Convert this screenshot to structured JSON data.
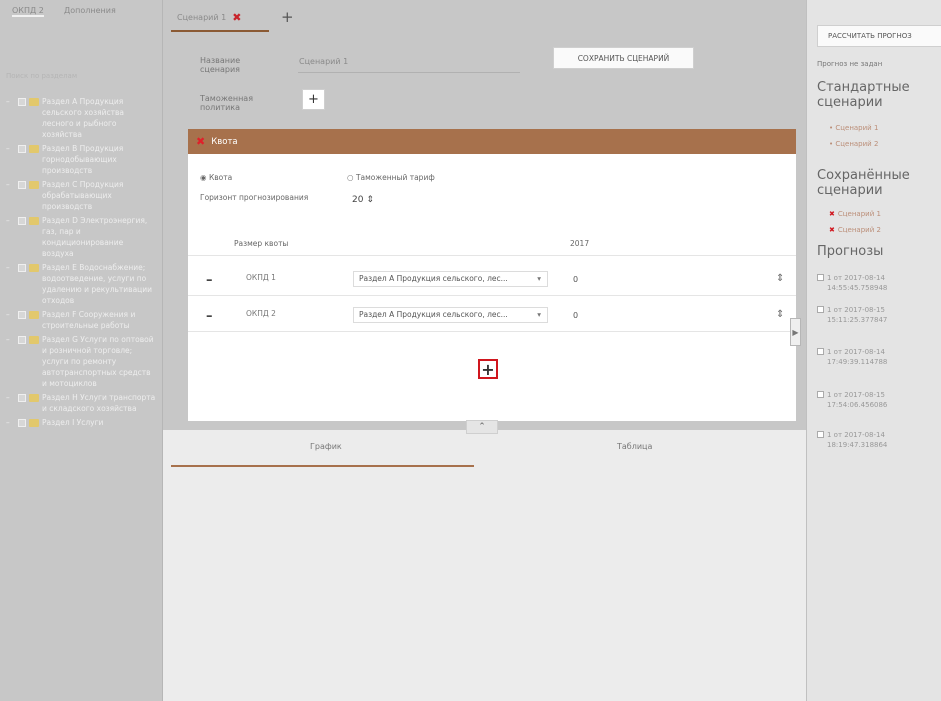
{
  "left_panel": {
    "tabs": [
      "ОКПД 2",
      "Дополнения"
    ],
    "search_placeholder": "Поиск по разделам",
    "tree": [
      {
        "prefix": "–",
        "label": "Раздел А Продукция сельского хозяйства лесного и рыбного хозяйства"
      },
      {
        "prefix": "–",
        "label": "Раздел В Продукция горнодобывающих производств"
      },
      {
        "prefix": "–",
        "label": "Раздел С Продукция обрабатывающих производств"
      },
      {
        "prefix": "–",
        "label": "Раздел D Электроэнергия, газ, пар и кондиционирование воздуха"
      },
      {
        "prefix": "–",
        "label": "Раздел Е Водоснабжение; водоотведение, услуги по удалению и рекультивации отходов"
      },
      {
        "prefix": "–",
        "label": "Раздел F Сооружения и строительные работы"
      },
      {
        "prefix": "–",
        "label": "Раздел G Услуги по оптовой и розничной торговле; услуги по ремонту автотранспортных средств и мотоциклов"
      },
      {
        "prefix": "–",
        "label": "Раздел Н Услуги транспорта и складского хозяйства"
      },
      {
        "prefix": "–",
        "label": "Раздел I Услуги"
      }
    ]
  },
  "scenario_tab": {
    "label": "Сценарий 1",
    "add_symbol": "+"
  },
  "form": {
    "name_label": "Название сценария",
    "name_value": "Сценарий 1",
    "save_button": "СОХРАНИТЬ СЦЕНАРИЙ",
    "policy_label": "Таможенная политика",
    "policy_add": "+"
  },
  "quota_card": {
    "title": "Квота",
    "radio_quota": "Квота",
    "radio_tariff": "Таможенный тариф",
    "horizon_label": "Горизонт прогнозирования",
    "horizon_value": "20",
    "size_header": "Размер квоты",
    "year_header": "2017",
    "rows": [
      {
        "okgd": "ОКПД 1",
        "select_value": "Раздел А Продукция сельского, лес...",
        "value": "0"
      },
      {
        "okgd": "ОКПД 2",
        "select_value": "Раздел А Продукция сельского, лес...",
        "value": "0"
      }
    ],
    "add_row": "+"
  },
  "bottom_tabs": [
    "График",
    "Таблица"
  ],
  "right_panel": {
    "calc_button": "РАССЧИТАТЬ ПРОГНОЗ",
    "note": "Прогноз не задан",
    "standard_heading": "Стандартные сценарии",
    "standard_items": [
      "Сценарий 1",
      "Сценарий 2"
    ],
    "saved_heading": "Сохранённые сценарии",
    "saved_items": [
      "Сценарий 1",
      "Сценарий 2"
    ],
    "forecast_heading": "Прогнозы",
    "forecasts": [
      "1 от 2017-08-14 14:55:45.758948",
      "1 от 2017-08-15 15:11:25.377847",
      "1 от 2017-08-14 17:49:39.114788",
      "1 от 2017-08-15 17:54:06.456086",
      "1 от 2017-08-14 18:19:47.318864"
    ]
  },
  "colors": {
    "accent": "#a7714c",
    "danger": "#d0161e",
    "gray_bg": "#c7c7c7"
  }
}
